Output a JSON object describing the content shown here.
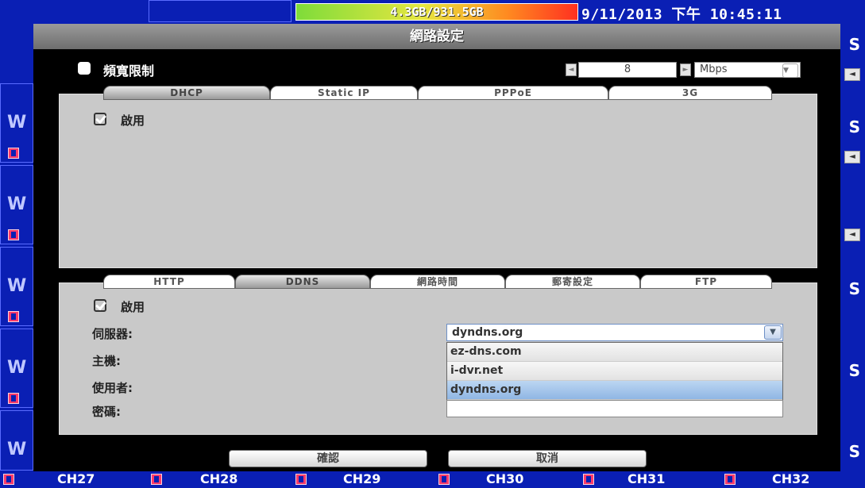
{
  "status_bar": {
    "hdd_usage": "4.3GB/931.5GB",
    "date": "9/11/2013",
    "ampm": "下午",
    "time": "10:45:11"
  },
  "channels": [
    "CH27",
    "CH28",
    "CH29",
    "CH30",
    "CH31",
    "CH32"
  ],
  "dialog": {
    "title": "網路設定",
    "bandwidth": {
      "label": "頻寬限制",
      "value": "8",
      "unit": "Mbps"
    },
    "connection_tabs": [
      "DHCP",
      "Static IP",
      "PPPoE",
      "3G"
    ],
    "connection_enable_label": "啟用",
    "service_tabs": [
      "HTTP",
      "DDNS",
      "網路時間",
      "郵寄設定",
      "FTP"
    ],
    "ddns": {
      "enable_label": "啟用",
      "server_label": "伺服器:",
      "host_label": "主機:",
      "user_label": "使用者:",
      "password_label": "密碼:",
      "server_selected": "dyndns.org",
      "server_options": [
        "ez-dns.com",
        "i-dvr.net",
        "dyndns.org"
      ]
    },
    "ok_label": "確認",
    "cancel_label": "取消"
  },
  "colors": {
    "desktop_blue": "#0a1fb4",
    "dialog_black": "#000000",
    "panel_gray": "#c9c9c9",
    "selected_option": "#8fb6e4"
  }
}
